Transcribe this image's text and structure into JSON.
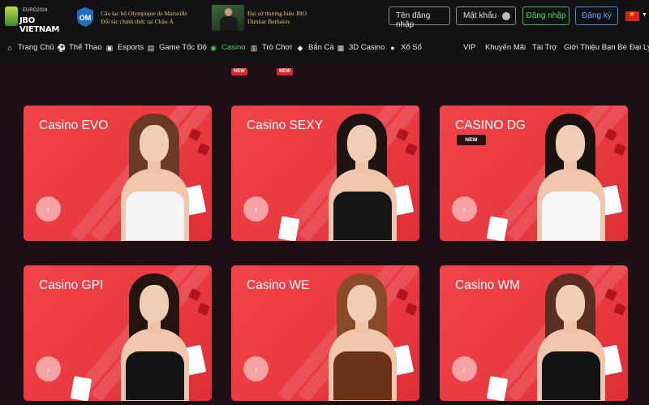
{
  "header": {
    "logo_sub": "EURO2024",
    "logo_brand": "JBO VIETNAM",
    "partner_line1": "Câu lạc bộ Olympique de Marseille",
    "partner_line2": "Đối tác chính thức tại Châu Á",
    "ambassador_line1": "Đại sứ thương hiệu JBO",
    "ambassador_line2": "Dimitar Berbatov",
    "username_placeholder": "Tên đăng nhập",
    "password_placeholder": "Mật khẩu",
    "login_label": "Đăng nhập",
    "register_label": "Đăng ký",
    "language": "vi"
  },
  "nav": {
    "items": [
      {
        "label": "Trang Chủ",
        "icon": "home-icon"
      },
      {
        "label": "Thể Thao",
        "icon": "soccer-ball-icon"
      },
      {
        "label": "Esports",
        "icon": "gamepad-icon"
      },
      {
        "label": "Game Tốc Độ",
        "icon": "speed-game-icon"
      },
      {
        "label": "Casino",
        "icon": "casino-chip-icon",
        "active": true,
        "badge": "NEW"
      },
      {
        "label": "Trò Chơi",
        "icon": "slot-machine-icon",
        "badge": "NEW"
      },
      {
        "label": "Bắn Cá",
        "icon": "fish-icon"
      },
      {
        "label": "3D Casino",
        "icon": "cube-icon"
      },
      {
        "label": "Xổ Số",
        "icon": "lottery-ball-icon"
      }
    ],
    "right_items": [
      "VIP",
      "Khuyến Mãi",
      "Tài Trợ",
      "Giới Thiệu Bạn Bè",
      "Đại Lý"
    ]
  },
  "games": [
    {
      "title": "Casino EVO",
      "outfit": "#f4f4f4",
      "hair": "#6b3a26",
      "badge": ""
    },
    {
      "title": "Casino SEXY",
      "outfit": "#161616",
      "hair": "#1d1412",
      "badge": ""
    },
    {
      "title": "CASINO DG",
      "outfit": "#f7f7f7",
      "hair": "#1b1210",
      "badge": "NEW"
    },
    {
      "title": "Casino GPI",
      "outfit": "#141414",
      "hair": "#24160f",
      "badge": ""
    },
    {
      "title": "Casino WE",
      "outfit": "#6a3216",
      "hair": "#8a4a2a",
      "badge": ""
    },
    {
      "title": "Casino WM",
      "outfit": "#141414",
      "hair": "#5a2e20",
      "badge": ""
    }
  ],
  "colors": {
    "card_red": "#ef4048",
    "active_green": "#4ecf3f",
    "register_blue": "#3a8ee6",
    "header_bg": "#121214",
    "page_bg": "#1e0f16"
  }
}
